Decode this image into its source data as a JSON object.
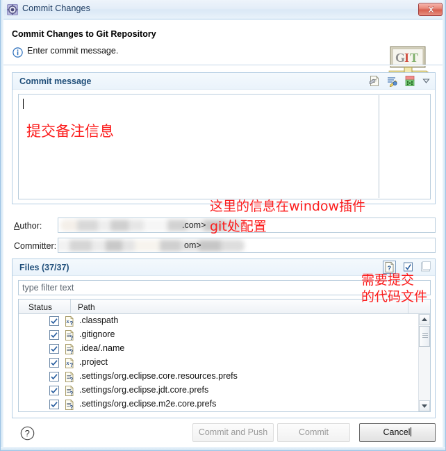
{
  "window": {
    "title": "Commit Changes",
    "title_icon": "gear-icon",
    "close_label": "close-icon"
  },
  "header": {
    "title": "Commit Changes to Git Repository",
    "message": "Enter commit message.",
    "info_icon": "info-icon",
    "logo_text": "GIT",
    "logo_letters": [
      "G",
      "I",
      "T"
    ]
  },
  "commit_message": {
    "group_title": "Commit message",
    "value": "",
    "toolbar": [
      {
        "name": "amend-commit-icon",
        "tooltip": "Amend"
      },
      {
        "name": "signed-off-icon",
        "tooltip": "Add Signed-off-by"
      },
      {
        "name": "change-id-icon",
        "tooltip": "Add Change-Id"
      },
      {
        "name": "chevron-down-icon",
        "tooltip": "More"
      }
    ]
  },
  "author": {
    "label": "Author:",
    "label_mnemonic": "A",
    "value_visible_tail": ".com>",
    "redacted": true
  },
  "committer": {
    "label": "Committer:",
    "label_mnemonic": "C",
    "value_visible_tail": "om>",
    "redacted": true
  },
  "files": {
    "group_title": "Files",
    "count_label": "(37/37)",
    "selected": 37,
    "total": 37,
    "toolbar": [
      {
        "name": "show-untracked-icon",
        "glyph": "?"
      },
      {
        "name": "select-all-icon",
        "glyph": "checked"
      },
      {
        "name": "deselect-all-icon",
        "glyph": "unchecked"
      }
    ],
    "filter_placeholder": "type filter text",
    "filter_value": "",
    "columns": [
      "Status",
      "Path"
    ],
    "rows": [
      {
        "checked": true,
        "icon": "xml-file-untracked-icon",
        "path": ".classpath"
      },
      {
        "checked": true,
        "icon": "text-file-untracked-icon",
        "path": ".gitignore"
      },
      {
        "checked": true,
        "icon": "text-file-untracked-icon",
        "path": ".idea/.name"
      },
      {
        "checked": true,
        "icon": "xml-file-untracked-icon",
        "path": ".project"
      },
      {
        "checked": true,
        "icon": "text-file-untracked-icon",
        "path": ".settings/org.eclipse.core.resources.prefs"
      },
      {
        "checked": true,
        "icon": "text-file-untracked-icon",
        "path": ".settings/org.eclipse.jdt.core.prefs"
      },
      {
        "checked": true,
        "icon": "text-file-untracked-icon",
        "path": ".settings/org.eclipse.m2e.core.prefs"
      }
    ],
    "scrollbar": {
      "position": "top",
      "visible": true
    }
  },
  "buttons": {
    "help": "help-icon",
    "commit_and_push": {
      "label": "Commit and Push",
      "mnemonic": "P",
      "enabled": false
    },
    "commit": {
      "label": "Commit",
      "mnemonic": "C",
      "enabled": false
    },
    "cancel": {
      "label": "Cancel",
      "enabled": true,
      "focused": true
    }
  },
  "annotations": {
    "color": "#fc1d1d",
    "commit_message_note": "提交备注信息",
    "config_note_line1": "这里的信息在window插件",
    "config_note_line2": "git处配置",
    "files_note_line1": "需要提交",
    "files_note_line2": "的代码文件"
  }
}
